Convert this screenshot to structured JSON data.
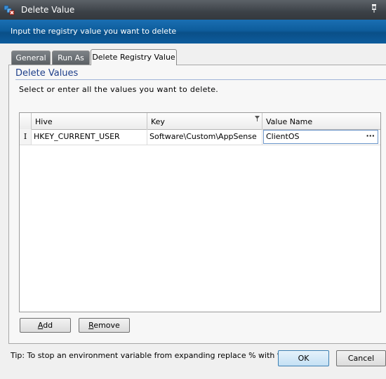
{
  "window": {
    "title": "Delete Value",
    "banner": "Input the registry value you want to delete"
  },
  "tabs": [
    {
      "label": "General",
      "active": false
    },
    {
      "label": "Run As",
      "active": false
    },
    {
      "label": "Delete Registry Value",
      "active": true
    }
  ],
  "group": {
    "title": "Delete Values",
    "instructions": "Select or enter all the values you want to delete."
  },
  "grid": {
    "columns": [
      "Hive",
      "Key",
      "Value Name"
    ],
    "rows": [
      {
        "indicator": "I",
        "hive": "HKEY_CURRENT_USER",
        "key": "Software\\Custom\\AppSense",
        "value_name": "ClientOS"
      }
    ],
    "ellipsis": "···"
  },
  "buttons": {
    "add": {
      "mnemonic": "A",
      "rest": "dd"
    },
    "remove": {
      "mnemonic": "R",
      "rest": "emove"
    },
    "ok": "OK",
    "cancel": "Cancel"
  },
  "tip": "Tip: To stop an environment variable from expanding replace % with %%.",
  "colors": {
    "banner": "#0e5d9c",
    "group_title": "#1e3f8a",
    "titlebar": "#3c4147"
  },
  "icons": [
    "app-registry-icon",
    "pin-icon",
    "filter-icon",
    "row-edit-icon"
  ]
}
